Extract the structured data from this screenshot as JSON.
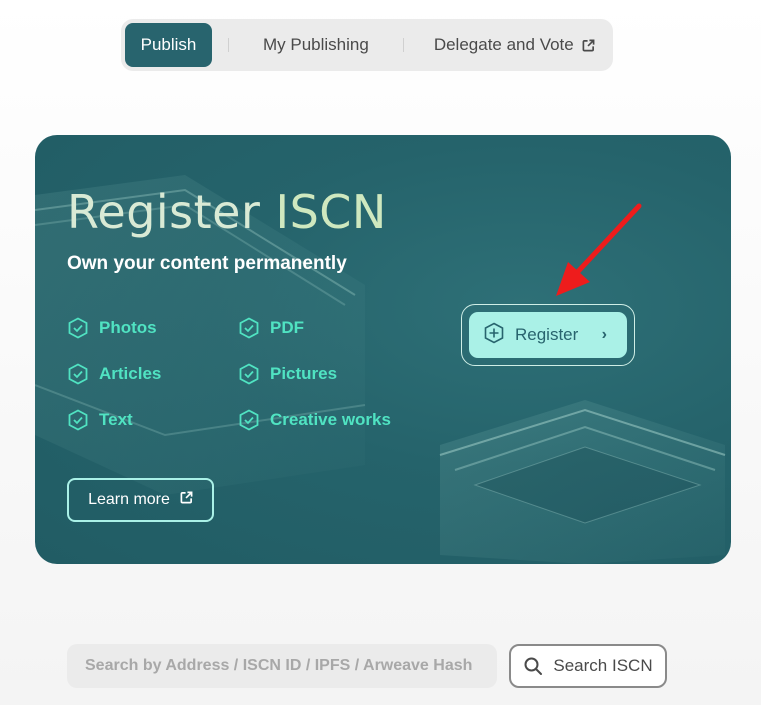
{
  "tabs": {
    "publish": "Publish",
    "my_publishing": "My Publishing",
    "delegate_vote": "Delegate and Vote"
  },
  "hero": {
    "title_main": "Register",
    "title_accent": "ISCN",
    "subtitle": "Own your content permanently",
    "features": [
      "Photos",
      "PDF",
      "Articles",
      "Pictures",
      "Text",
      "Creative works"
    ],
    "register_label": "Register",
    "learn_more_label": "Learn more"
  },
  "search": {
    "placeholder": "Search by Address / ISCN ID / IPFS / Arweave Hash",
    "button_label": "Search ISCN"
  },
  "icons": {
    "feature": "shield-check-icon",
    "external": "external-link-icon",
    "register": "plus-circle-icon",
    "register_chevron": "chevron-right-icon",
    "search": "search-icon"
  },
  "colors": {
    "brand": "#28646e",
    "accent": "#50e3c2",
    "register_bg": "#aaf1e7"
  }
}
